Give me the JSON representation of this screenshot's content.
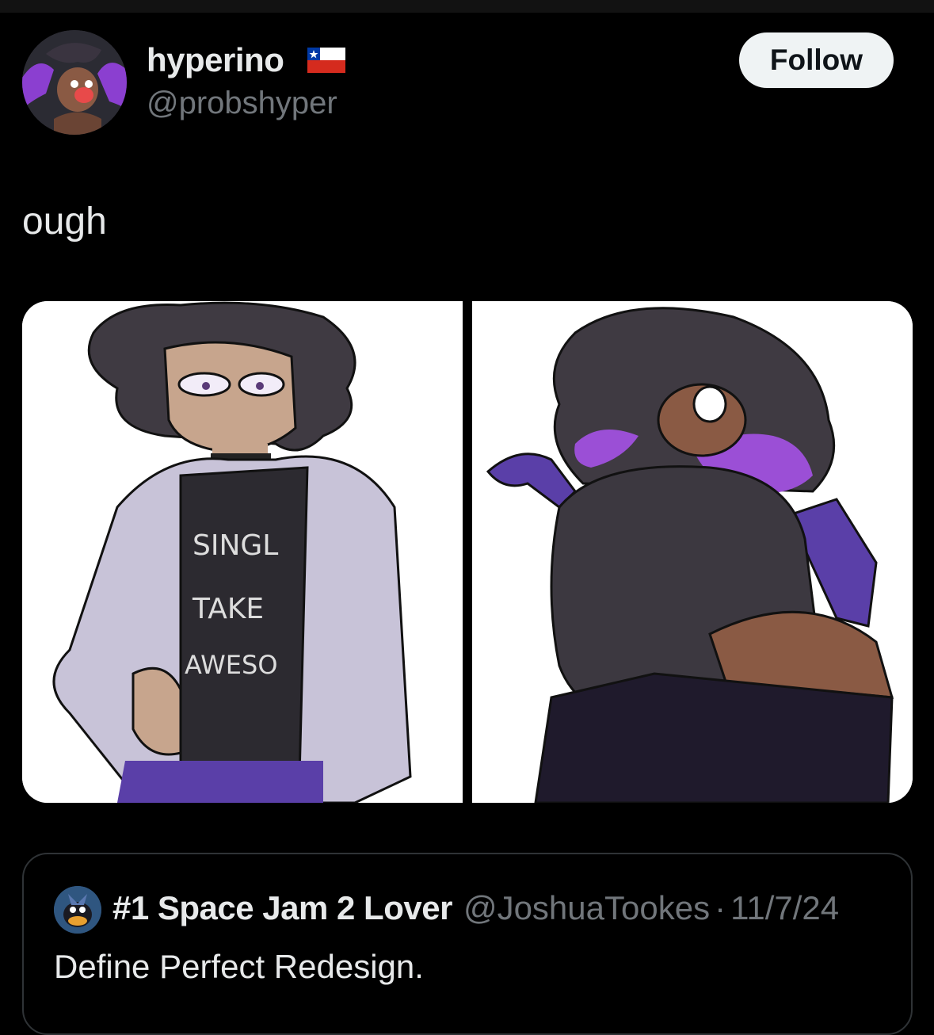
{
  "author": {
    "name": "hyperino",
    "handle": "@probshyper",
    "flag_icon": "chile-flag-icon"
  },
  "follow_button": {
    "label": "Follow"
  },
  "post": {
    "text": "ough"
  },
  "quoted_post": {
    "name": "#1 Space Jam 2 Lover",
    "handle": "@JoshuaTookes",
    "separator": "·",
    "date": "11/7/24",
    "text": "Define Perfect Redesign."
  },
  "colors": {
    "background": "#000000",
    "primary_text": "#e7e9ea",
    "secondary_text": "#71767b",
    "follow_bg": "#eff3f4",
    "border": "#2f3336",
    "accent_purple": "#9b4fd6"
  }
}
